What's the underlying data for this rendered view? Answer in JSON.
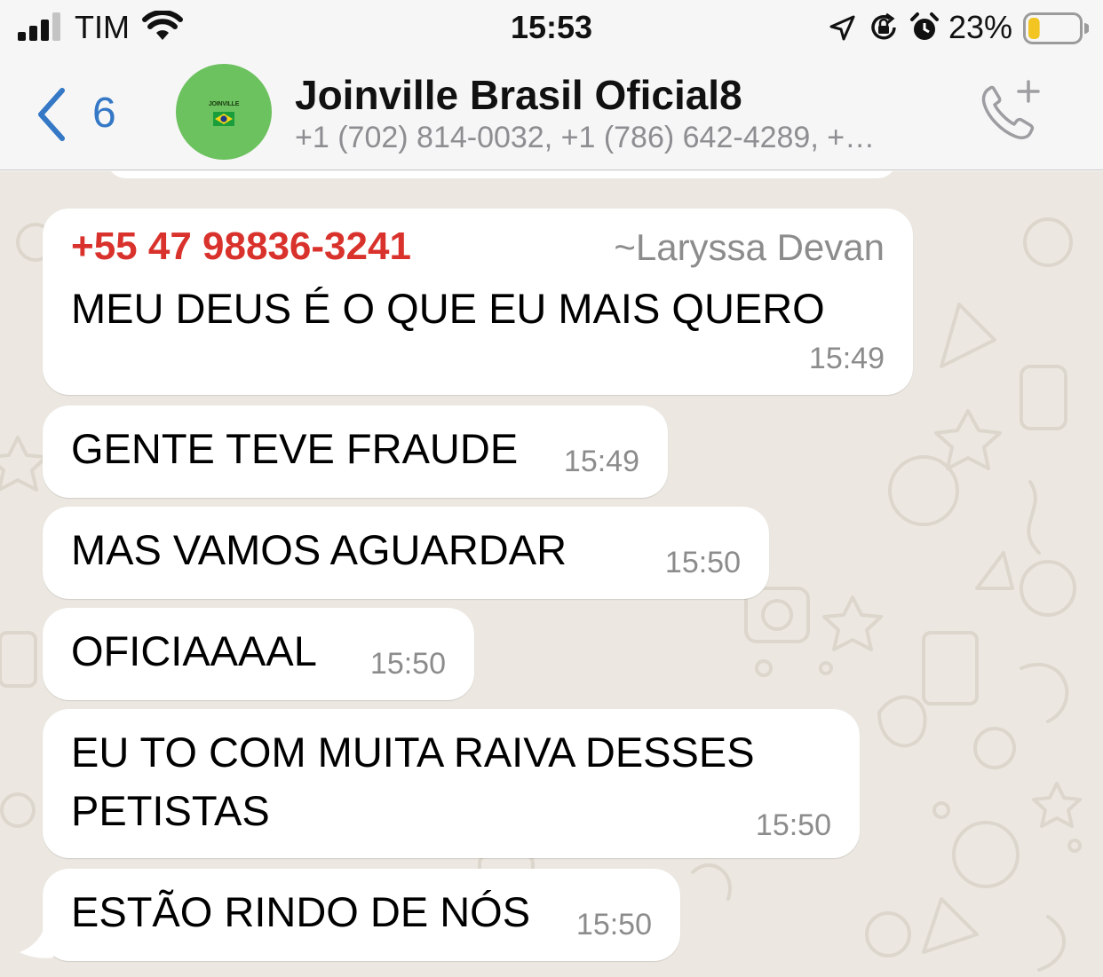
{
  "status_bar": {
    "carrier": "TIM",
    "time": "15:53",
    "battery_percent": "23%",
    "battery_level": 0.23,
    "signal_bars": 3,
    "icons": [
      "signal-icon",
      "wifi-icon",
      "location-icon",
      "orientation-lock-icon",
      "alarm-icon",
      "battery-icon"
    ]
  },
  "header": {
    "back_count": "6",
    "avatar_text": "JOINVILLE",
    "title": "Joinville Brasil Oficial8",
    "subtitle": "+1 (702) 814-0032, +1 (786) 642-4289, +…",
    "icons": [
      "back-chevron-icon",
      "add-call-icon"
    ]
  },
  "colors": {
    "accent": "#3478c6",
    "sender_red": "#d9322c",
    "avatar_green": "#6cc25e",
    "bubble_bg": "#ffffff",
    "chat_bg": "#ece8e1"
  },
  "messages": [
    {
      "sender_phone": "+55 47 98836-3241",
      "sender_name": "~Laryssa Devan",
      "text": "MEU DEUS É O QUE EU MAIS QUERO",
      "time": "15:49"
    },
    {
      "text": "GENTE TEVE FRAUDE",
      "time": "15:49"
    },
    {
      "text": "MAS VAMOS AGUARDAR",
      "time": "15:50"
    },
    {
      "text": "OFICIAAAAL",
      "time": "15:50"
    },
    {
      "lines": [
        "EU TO COM MUITA RAIVA DESSES",
        "PETISTAS"
      ],
      "time": "15:50"
    },
    {
      "text": "ESTÃO RINDO DE NÓS",
      "time": "15:50"
    }
  ]
}
